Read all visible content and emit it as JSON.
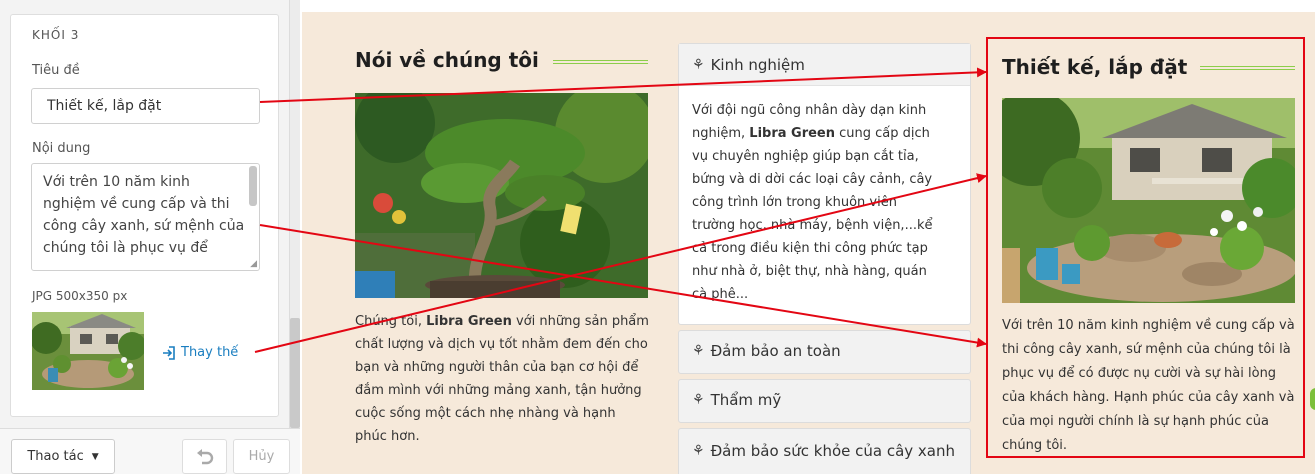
{
  "editor": {
    "block_title": "KHỐI 3",
    "title_label": "Tiêu đề",
    "title_value": "Thiết kế, lắp đặt",
    "content_label": "Nội dung",
    "content_value": "Với trên 10 năm kinh nghiệm về cung cấp và thi công cây xanh, sứ mệnh của chúng tôi là phục vụ để",
    "image_spec": "JPG 500x350 px",
    "replace_label": "Thay thế",
    "actions_label": "Thao tác",
    "cancel_label": "Hủy"
  },
  "preview": {
    "about": {
      "title": "Nói về chúng tôi",
      "text_before": "Chúng tôi, ",
      "text_bold": "Libra Green",
      "text_after": " với những sản phẩm chất lượng và dịch vụ tốt nhằm đem đến cho bạn và những người thân của bạn cơ hội để đắm mình với những mảng xanh, tận hưởng cuộc sống một cách nhẹ nhàng và hạnh phúc hơn."
    },
    "accordion": [
      {
        "label": "Kinh nghiệm",
        "expanded": true,
        "body_before": "Với đội ngũ công nhân dày dạn kinh nghiệm, ",
        "body_bold": "Libra Green",
        "body_after": " cung cấp dịch vụ chuyên nghiệp giúp bạn cắt tỉa, bứng và di dời các loại cây cảnh, cây công trình lớn trong khuôn viên trường học, nhà máy, bệnh viện,...kể cả trong điều kiện thi công phức tạp như nhà ở, biệt thự, nhà hàng, quán cà phê..."
      },
      {
        "label": "Đảm bảo an toàn",
        "expanded": false
      },
      {
        "label": "Thẩm mỹ",
        "expanded": false
      },
      {
        "label": "Đảm bảo sức khỏe của cây xanh",
        "expanded": false
      }
    ],
    "install": {
      "title": "Thiết kế, lắp đặt",
      "text": "Với trên 10 năm kinh nghiệm về cung cấp và thi công cây xanh, sứ mệnh của chúng tôi là phục vụ để có được nụ cười và sự hài lòng của khách hàng. Hạnh phúc của cây xanh và của mọi người chính là sự hạnh phúc của chúng tôi."
    }
  },
  "icons": {
    "accordion_icon": "leaf-icon",
    "replace_icon": "sign-in-icon",
    "actions_caret": "caret-down-icon",
    "undo_icon": "undo-icon"
  },
  "colors": {
    "highlight_border": "#e30613",
    "annotation_arrow": "#e30613",
    "title_underline": "#8ccd4a",
    "preview_background": "#f6e9da",
    "link": "#1a7ec0"
  }
}
